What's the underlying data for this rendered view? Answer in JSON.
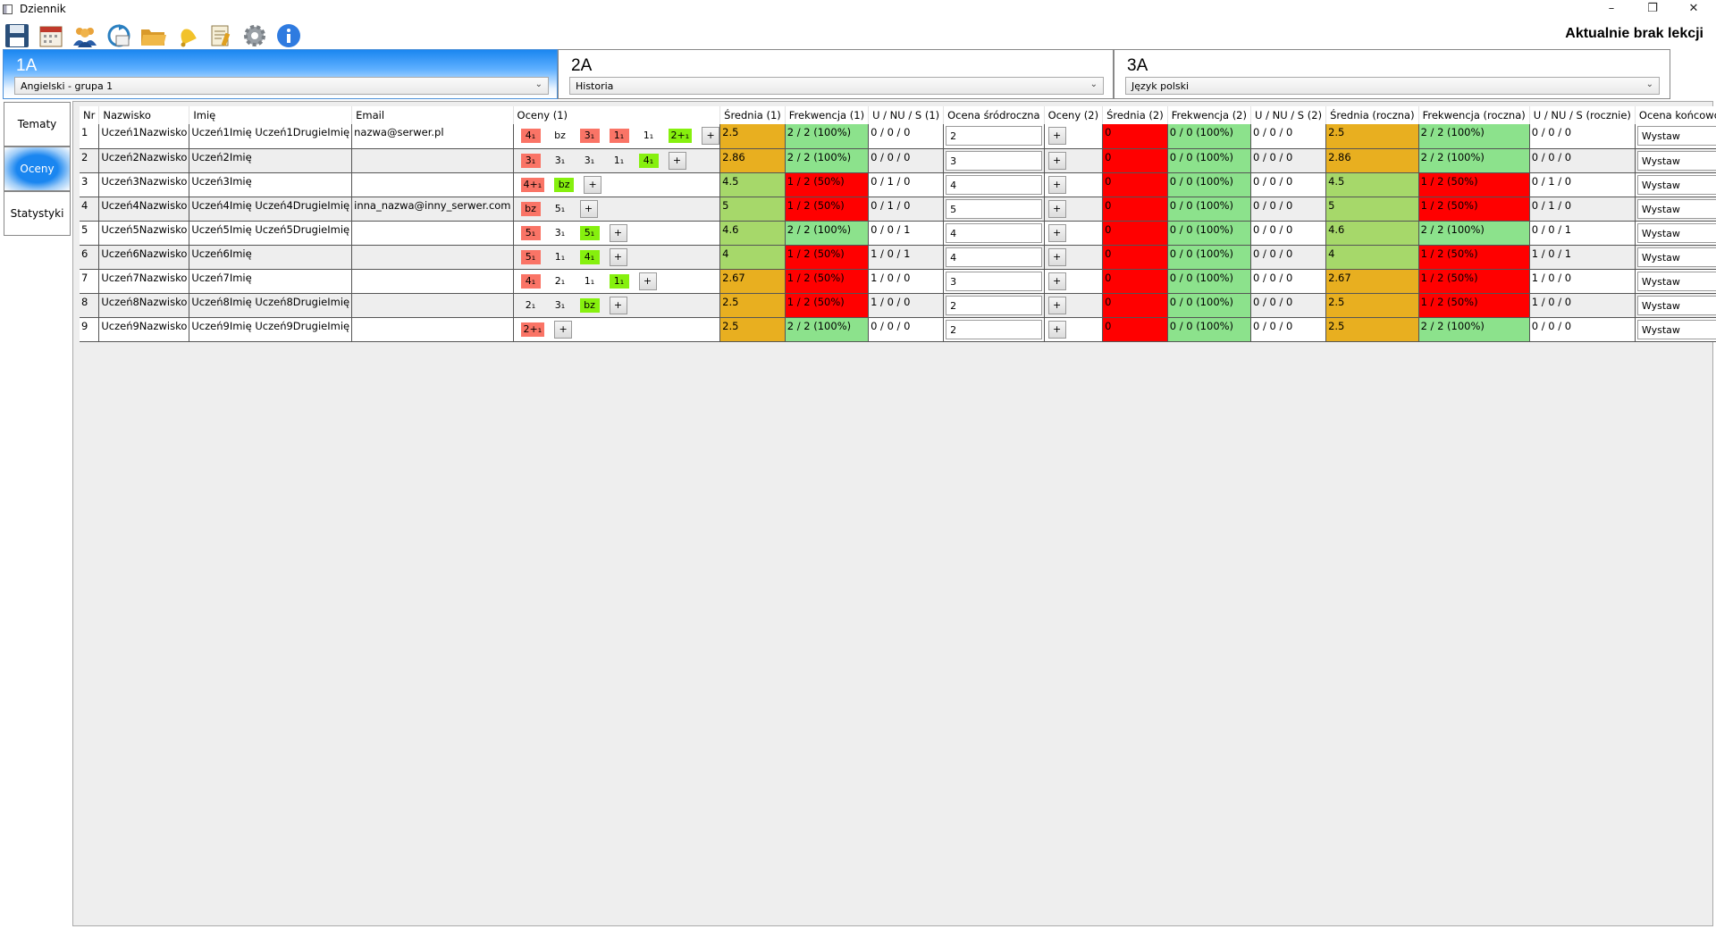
{
  "window": {
    "title": "Dziennik",
    "minimize": "–",
    "restore": "❐",
    "close": "✕"
  },
  "toolbar": {
    "icons": [
      "save-icon",
      "calendar-icon",
      "users-icon",
      "sync-icon",
      "folder-icon",
      "bell-icon",
      "notes-icon",
      "settings-icon",
      "info-icon"
    ]
  },
  "status_text": "Aktualnie brak lekcji",
  "class_tabs": [
    {
      "name": "1A",
      "subject": "Angielski - grupa 1",
      "active": true
    },
    {
      "name": "2A",
      "subject": "Historia",
      "active": false
    },
    {
      "name": "3A",
      "subject": "Język polski",
      "active": false
    }
  ],
  "side_nav": [
    {
      "label": "Tematy",
      "active": false
    },
    {
      "label": "Oceny",
      "active": true
    },
    {
      "label": "Statystyki",
      "active": false
    }
  ],
  "columns": [
    "Nr",
    "Nazwisko",
    "Imię",
    "Email",
    "Oceny (1)",
    "Średnia (1)",
    "Frekwencja (1)",
    "U / NU / S (1)",
    "Ocena śródroczna",
    "Oceny (2)",
    "Średnia (2)",
    "Frekwencja (2)",
    "U / NU / S (2)",
    "Średnia (roczna)",
    "Frekwencja (roczna)",
    "U / NU / S (rocznie)",
    "Ocena końcoworoczna"
  ],
  "add_label": "+",
  "final_label": "Wystaw",
  "colors": {
    "red": "#ff0000",
    "orange": "#e8af20",
    "light_green": "#a6d86a",
    "green": "#8ce28c",
    "grade_red": "#fa7466",
    "grade_green": "#86f00e",
    "accent_blue": "#1a86f0"
  },
  "rows": [
    {
      "nr": "1",
      "surname": "Uczeń1Nazwisko",
      "name": "Uczeń1Imię Uczeń1DrugieImię",
      "email": "nazwa@serwer.pl",
      "grades1": [
        {
          "t": "4₁",
          "c": "red"
        },
        {
          "t": "bz",
          "c": ""
        },
        {
          "t": "3₁",
          "c": "red"
        },
        {
          "t": "1₁",
          "c": "red"
        },
        {
          "t": "1₁",
          "c": ""
        },
        {
          "t": "2+₁",
          "c": "green"
        }
      ],
      "avg1": "2.5",
      "avg1_color": "orange",
      "att1": "2 / 2 (100%)",
      "att1_color": "green",
      "uns1": "0 / 0 / 0",
      "mid": "2",
      "avg2": "0",
      "att2": "0 / 0 (100%)",
      "uns2": "0 / 0 / 0",
      "avgY": "2.5",
      "avgY_color": "orange",
      "attY": "2 / 2 (100%)",
      "attY_color": "green",
      "unsY": "0 / 0 / 0"
    },
    {
      "nr": "2",
      "surname": "Uczeń2Nazwisko",
      "name": "Uczeń2Imię",
      "email": "",
      "grades1": [
        {
          "t": "3₁",
          "c": "red"
        },
        {
          "t": "3₁",
          "c": ""
        },
        {
          "t": "3₁",
          "c": ""
        },
        {
          "t": "1₁",
          "c": ""
        },
        {
          "t": "4₁",
          "c": "green"
        }
      ],
      "avg1": "2.86",
      "avg1_color": "orange",
      "att1": "2 / 2 (100%)",
      "att1_color": "green",
      "uns1": "0 / 0 / 0",
      "mid": "3",
      "avg2": "0",
      "att2": "0 / 0 (100%)",
      "uns2": "0 / 0 / 0",
      "avgY": "2.86",
      "avgY_color": "orange",
      "attY": "2 / 2 (100%)",
      "attY_color": "green",
      "unsY": "0 / 0 / 0"
    },
    {
      "nr": "3",
      "surname": "Uczeń3Nazwisko",
      "name": "Uczeń3Imię",
      "email": "",
      "grades1": [
        {
          "t": "4+₁",
          "c": "red"
        },
        {
          "t": "bz",
          "c": "green"
        }
      ],
      "avg1": "4.5",
      "avg1_color": "light_green",
      "att1": "1 / 2 (50%)",
      "att1_color": "red",
      "uns1": "0 / 1 / 0",
      "mid": "4",
      "avg2": "0",
      "att2": "0 / 0 (100%)",
      "uns2": "0 / 0 / 0",
      "avgY": "4.5",
      "avgY_color": "light_green",
      "attY": "1 / 2 (50%)",
      "attY_color": "red",
      "unsY": "0 / 1 / 0"
    },
    {
      "nr": "4",
      "surname": "Uczeń4Nazwisko",
      "name": "Uczeń4Imię Uczeń4DrugieImię",
      "email": "inna_nazwa@inny_serwer.com",
      "grades1": [
        {
          "t": "bz",
          "c": "red"
        },
        {
          "t": "5₁",
          "c": ""
        }
      ],
      "avg1": "5",
      "avg1_color": "light_green",
      "att1": "1 / 2 (50%)",
      "att1_color": "red",
      "uns1": "0 / 1 / 0",
      "mid": "5",
      "avg2": "0",
      "att2": "0 / 0 (100%)",
      "uns2": "0 / 0 / 0",
      "avgY": "5",
      "avgY_color": "light_green",
      "attY": "1 / 2 (50%)",
      "attY_color": "red",
      "unsY": "0 / 1 / 0"
    },
    {
      "nr": "5",
      "surname": "Uczeń5Nazwisko",
      "name": "Uczeń5Imię Uczeń5DrugieImię",
      "email": "",
      "grades1": [
        {
          "t": "5₁",
          "c": "red"
        },
        {
          "t": "3₁",
          "c": ""
        },
        {
          "t": "5₁",
          "c": "green"
        }
      ],
      "avg1": "4.6",
      "avg1_color": "light_green",
      "att1": "2 / 2 (100%)",
      "att1_color": "green",
      "uns1": "0 / 0 / 1",
      "mid": "4",
      "avg2": "0",
      "att2": "0 / 0 (100%)",
      "uns2": "0 / 0 / 0",
      "avgY": "4.6",
      "avgY_color": "light_green",
      "attY": "2 / 2 (100%)",
      "attY_color": "green",
      "unsY": "0 / 0 / 1"
    },
    {
      "nr": "6",
      "surname": "Uczeń6Nazwisko",
      "name": "Uczeń6Imię",
      "email": "",
      "grades1": [
        {
          "t": "5₁",
          "c": "red"
        },
        {
          "t": "1₁",
          "c": ""
        },
        {
          "t": "4₁",
          "c": "green"
        }
      ],
      "avg1": "4",
      "avg1_color": "light_green",
      "att1": "1 / 2 (50%)",
      "att1_color": "red",
      "uns1": "1 / 0 / 1",
      "mid": "4",
      "avg2": "0",
      "att2": "0 / 0 (100%)",
      "uns2": "0 / 0 / 0",
      "avgY": "4",
      "avgY_color": "light_green",
      "attY": "1 / 2 (50%)",
      "attY_color": "red",
      "unsY": "1 / 0 / 1"
    },
    {
      "nr": "7",
      "surname": "Uczeń7Nazwisko",
      "name": "Uczeń7Imię",
      "email": "",
      "grades1": [
        {
          "t": "4₁",
          "c": "red"
        },
        {
          "t": "2₁",
          "c": ""
        },
        {
          "t": "1₁",
          "c": ""
        },
        {
          "t": "1₁",
          "c": "green"
        }
      ],
      "avg1": "2.67",
      "avg1_color": "orange",
      "att1": "1 / 2 (50%)",
      "att1_color": "red",
      "uns1": "1 / 0 / 0",
      "mid": "3",
      "avg2": "0",
      "att2": "0 / 0 (100%)",
      "uns2": "0 / 0 / 0",
      "avgY": "2.67",
      "avgY_color": "orange",
      "attY": "1 / 2 (50%)",
      "attY_color": "red",
      "unsY": "1 / 0 / 0"
    },
    {
      "nr": "8",
      "surname": "Uczeń8Nazwisko",
      "name": "Uczeń8Imię Uczeń8DrugieImię",
      "email": "",
      "grades1": [
        {
          "t": "2₁",
          "c": ""
        },
        {
          "t": "3₁",
          "c": ""
        },
        {
          "t": "bz",
          "c": "green"
        }
      ],
      "avg1": "2.5",
      "avg1_color": "orange",
      "att1": "1 / 2 (50%)",
      "att1_color": "red",
      "uns1": "1 / 0 / 0",
      "mid": "2",
      "avg2": "0",
      "att2": "0 / 0 (100%)",
      "uns2": "0 / 0 / 0",
      "avgY": "2.5",
      "avgY_color": "orange",
      "attY": "1 / 2 (50%)",
      "attY_color": "red",
      "unsY": "1 / 0 / 0"
    },
    {
      "nr": "9",
      "surname": "Uczeń9Nazwisko",
      "name": "Uczeń9Imię Uczeń9DrugieImię",
      "email": "",
      "grades1": [
        {
          "t": "2+₁",
          "c": "red"
        }
      ],
      "avg1": "2.5",
      "avg1_color": "orange",
      "att1": "2 / 2 (100%)",
      "att1_color": "green",
      "uns1": "0 / 0 / 0",
      "mid": "2",
      "avg2": "0",
      "att2": "0 / 0 (100%)",
      "uns2": "0 / 0 / 0",
      "avgY": "2.5",
      "avgY_color": "orange",
      "attY": "2 / 2 (100%)",
      "attY_color": "green",
      "unsY": "0 / 0 / 0"
    }
  ]
}
